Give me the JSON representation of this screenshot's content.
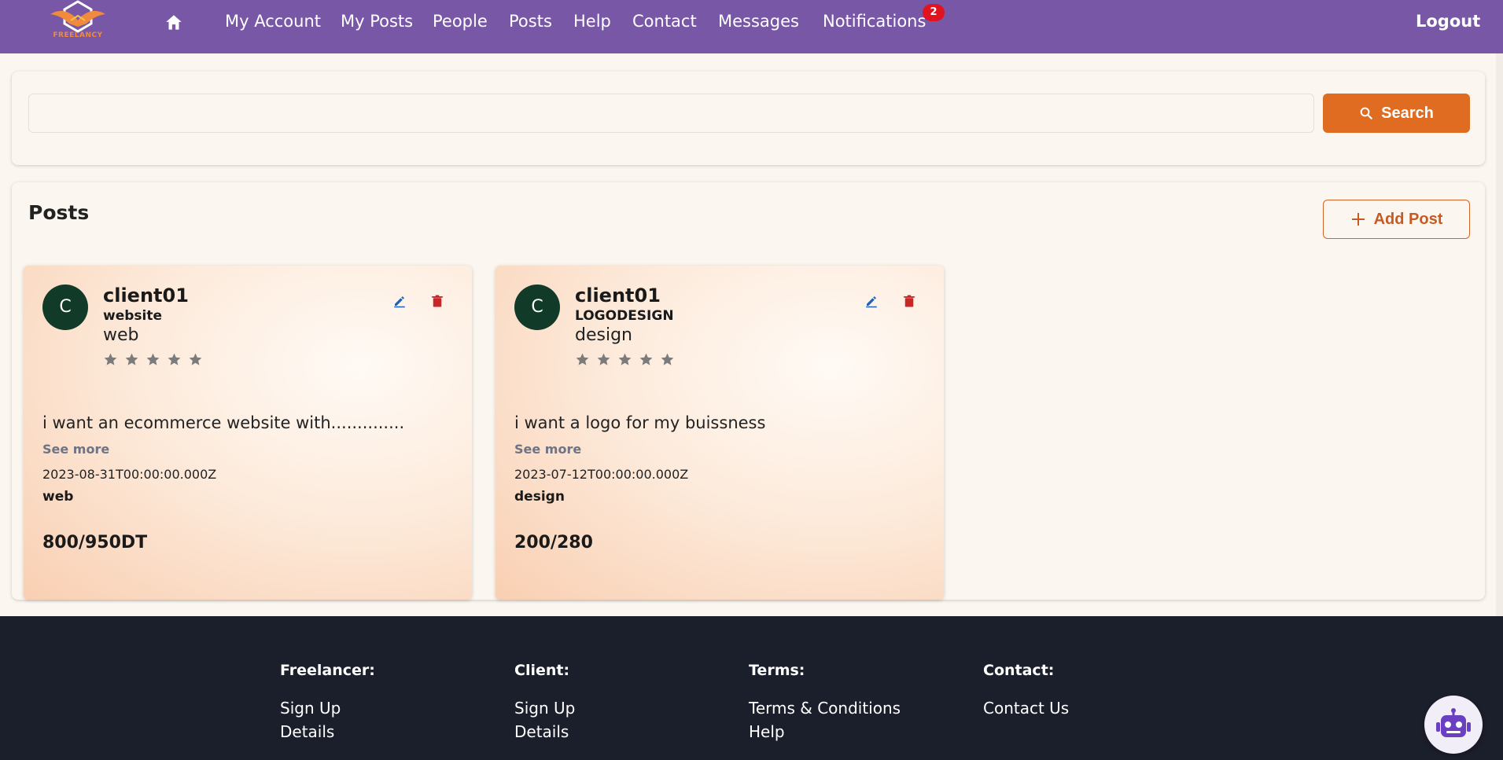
{
  "brand": {
    "logo_text": "FREELANCY",
    "primary_color": "#7858a6",
    "accent_color": "#e06c22"
  },
  "nav": {
    "home_icon": "home-icon",
    "items": [
      {
        "label": "My Account"
      },
      {
        "label": "My Posts"
      },
      {
        "label": "People"
      },
      {
        "label": "Posts"
      },
      {
        "label": "Help"
      },
      {
        "label": "Contact"
      },
      {
        "label": "Messages"
      },
      {
        "label": "Notifications"
      }
    ],
    "notifications_count": "2",
    "logout_label": "Logout"
  },
  "search": {
    "value": "",
    "placeholder": "",
    "button_label": "Search",
    "icon": "search-icon"
  },
  "posts": {
    "heading": "Posts",
    "add_label": "Add Post",
    "items": [
      {
        "avatar_letter": "C",
        "author": "client01",
        "title": "website",
        "category": "web",
        "rating": 0,
        "rating_max": 5,
        "description": "i want an ecommerce website with..............",
        "see_more": "See more",
        "date": "2023-08-31T00:00:00.000Z",
        "tag": "web",
        "budget": "800/950DT"
      },
      {
        "avatar_letter": "C",
        "author": "client01",
        "title": "LOGODESIGN",
        "category": "design",
        "rating": 0,
        "rating_max": 5,
        "description": "i want a logo for my buissness",
        "see_more": "See more",
        "date": "2023-07-12T00:00:00.000Z",
        "tag": "design",
        "budget": "200/280"
      }
    ]
  },
  "footer": {
    "columns": [
      {
        "heading": "Freelancer:",
        "links": [
          "Sign Up",
          "Details"
        ]
      },
      {
        "heading": "Client:",
        "links": [
          "Sign Up",
          "Details"
        ]
      },
      {
        "heading": "Terms:",
        "links": [
          "Terms & Conditions",
          "Help"
        ]
      },
      {
        "heading": "Contact:",
        "links": [
          "Contact Us"
        ]
      }
    ]
  },
  "chatbot": {
    "icon": "robot-icon"
  }
}
